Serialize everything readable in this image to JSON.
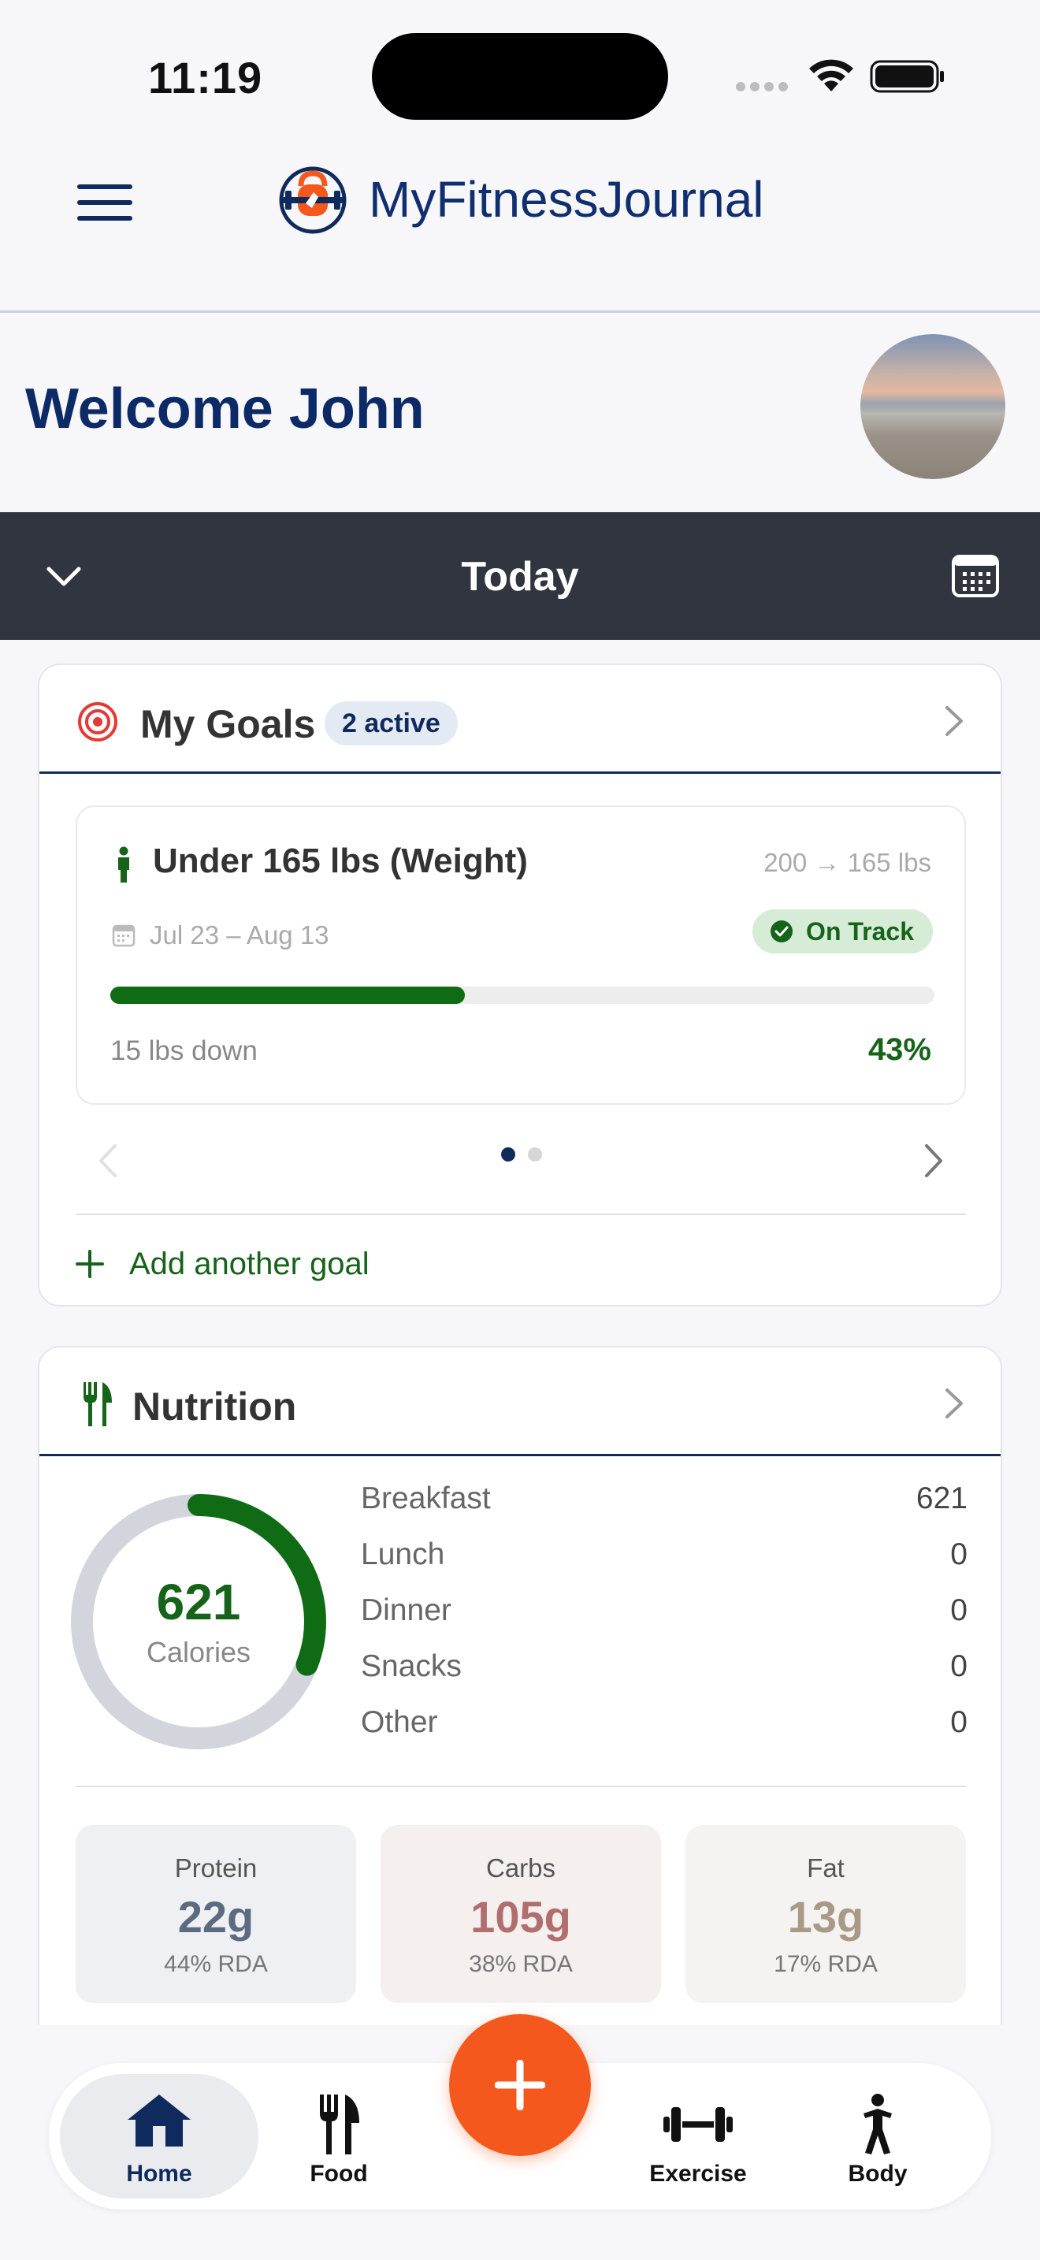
{
  "status_bar": {
    "time": "11:19"
  },
  "header": {
    "brand": "MyFitnessJournal",
    "menu_icon": "hamburger-icon",
    "logo_icon": "kettlebell-logo-icon"
  },
  "welcome": {
    "text": "Welcome John"
  },
  "date_bar": {
    "label": "Today"
  },
  "goals": {
    "title": "My Goals",
    "badge": "2 active",
    "goal": {
      "title": "Under 165 lbs (Weight)",
      "range": "200 → 165 lbs",
      "dates": "Jul 23 – Aug 13",
      "status": "On Track",
      "progress_percent": 43,
      "progress_text": "15 lbs down",
      "percent_label": "43%"
    },
    "pager": {
      "current": 1,
      "total": 2
    },
    "add_label": "Add another goal"
  },
  "nutrition": {
    "title": "Nutrition",
    "calories": "621",
    "calories_label": "Calories",
    "ring_fraction": 0.31,
    "meals": [
      {
        "name": "Breakfast",
        "value": "621"
      },
      {
        "name": "Lunch",
        "value": "0"
      },
      {
        "name": "Dinner",
        "value": "0"
      },
      {
        "name": "Snacks",
        "value": "0"
      },
      {
        "name": "Other",
        "value": "0"
      }
    ],
    "macros": [
      {
        "name": "Protein",
        "value": "22g",
        "rda": "44% RDA"
      },
      {
        "name": "Carbs",
        "value": "105g",
        "rda": "38% RDA"
      },
      {
        "name": "Fat",
        "value": "13g",
        "rda": "17% RDA"
      }
    ]
  },
  "nav": {
    "items": [
      {
        "label": "Home",
        "icon": "home-icon",
        "active": true
      },
      {
        "label": "Food",
        "icon": "fork-knife-icon",
        "active": false
      },
      {
        "label": "Exercise",
        "icon": "dumbbell-icon",
        "active": false
      },
      {
        "label": "Body",
        "icon": "person-icon",
        "active": false
      }
    ],
    "fab_icon": "plus-icon"
  },
  "colors": {
    "navy": "#0f2a5c",
    "green": "#16631a",
    "orange": "#f4581c",
    "dark_bar": "#30353f"
  }
}
